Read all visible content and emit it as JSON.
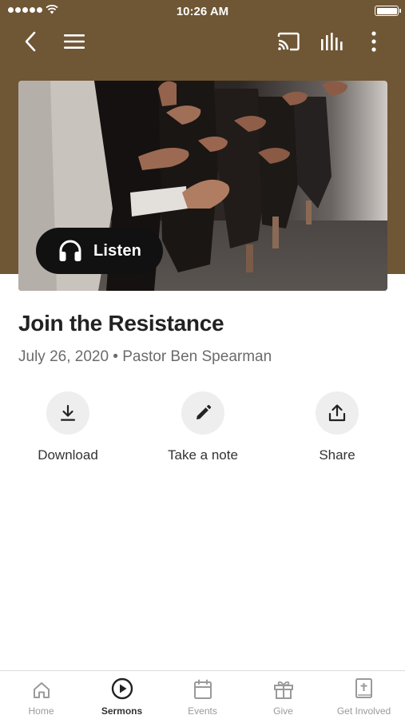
{
  "status_bar": {
    "time": "10:26 AM"
  },
  "nav": {
    "back_icon": "chevron-left-icon",
    "menu_icon": "hamburger-menu-icon",
    "cast_icon": "cast-icon",
    "audio_icon": "audio-levels-icon",
    "more_icon": "more-vertical-icon"
  },
  "hero": {
    "listen_label": "Listen",
    "listen_icon": "headphones-icon"
  },
  "sermon": {
    "title": "Join the Resistance",
    "meta": "July 26, 2020 • Pastor Ben Spearman"
  },
  "actions": [
    {
      "label": "Download",
      "icon": "download-icon"
    },
    {
      "label": "Take a note",
      "icon": "pencil-icon"
    },
    {
      "label": "Share",
      "icon": "share-icon"
    }
  ],
  "tabs": [
    {
      "label": "Home",
      "icon": "home-icon",
      "active": false
    },
    {
      "label": "Sermons",
      "icon": "play-circle-icon",
      "active": true
    },
    {
      "label": "Events",
      "icon": "calendar-icon",
      "active": false
    },
    {
      "label": "Give",
      "icon": "gift-icon",
      "active": false
    },
    {
      "label": "Get Involved",
      "icon": "bible-icon",
      "active": false
    }
  ],
  "colors": {
    "header_brown": "#6f5634",
    "listen_button": "#111111",
    "action_circle": "#eeeeee",
    "tab_inactive": "#9a9a9a",
    "tab_active": "#333333"
  }
}
